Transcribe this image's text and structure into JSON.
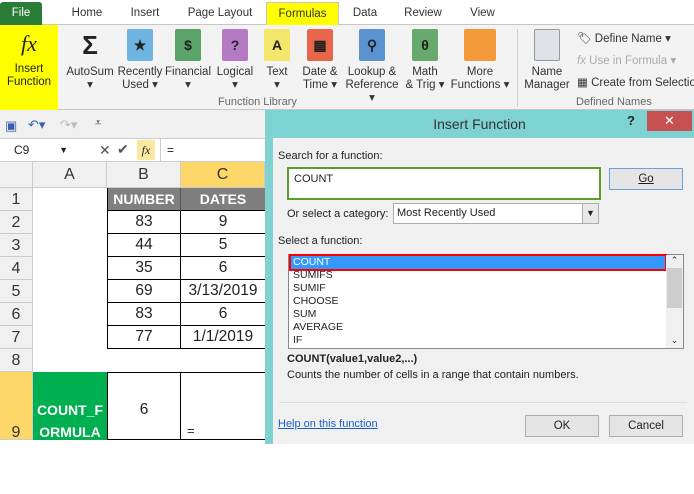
{
  "tabs": [
    "File",
    "Home",
    "Insert",
    "Page Layout",
    "Formulas",
    "Data",
    "Review",
    "View"
  ],
  "ribbon": {
    "insert_function": [
      "Insert",
      "Function"
    ],
    "buttons": [
      {
        "l1": "AutoSum",
        "l2": "▾",
        "icon": "sigma-icon"
      },
      {
        "l1": "Recently",
        "l2": "Used ▾",
        "icon": "star-book-icon"
      },
      {
        "l1": "Financial",
        "l2": "▾",
        "icon": "financial-book-icon"
      },
      {
        "l1": "Logical",
        "l2": "▾",
        "icon": "question-book-icon"
      },
      {
        "l1": "Text",
        "l2": "▾",
        "icon": "text-book-icon"
      },
      {
        "l1": "Date &",
        "l2": "Time ▾",
        "icon": "calendar-book-icon"
      },
      {
        "l1": "Lookup &",
        "l2": "Reference ▾",
        "icon": "magnifier-book-icon"
      },
      {
        "l1": "Math",
        "l2": "& Trig ▾",
        "icon": "theta-book-icon"
      },
      {
        "l1": "More",
        "l2": "Functions ▾",
        "icon": "books-icon"
      }
    ],
    "function_library": "Function Library",
    "name_manager": [
      "Name",
      "Manager"
    ],
    "define_name": "Define Name ▾",
    "use_in_formula": "Use in Formula ▾",
    "create_from_selection": "Create from Selection",
    "defined_names": "Defined Names"
  },
  "formula_bar": {
    "name_box": "C9",
    "formula": "="
  },
  "sheet": {
    "columns": [
      "A",
      "B",
      "C"
    ],
    "rows": [
      "1",
      "2",
      "3",
      "4",
      "5",
      "6",
      "7",
      "8",
      "9"
    ],
    "header": [
      "NUMBER",
      "DATES"
    ],
    "data": [
      [
        "83",
        "9"
      ],
      [
        "44",
        "5"
      ],
      [
        "35",
        "6"
      ],
      [
        "69",
        "3/13/2019"
      ],
      [
        "83",
        "6"
      ],
      [
        "77",
        "1/1/2019"
      ]
    ],
    "a9": "COUNT_FORMULA",
    "b9": "6",
    "c9": "="
  },
  "dialog": {
    "title": "Insert Function",
    "help": "?",
    "search_label": "Search for a function:",
    "search_value": "COUNT",
    "go": "Go",
    "category_label": "Or select a category:",
    "category": "Most Recently Used",
    "select_label": "Select a function:",
    "functions": [
      "COUNT",
      "SUMIFS",
      "SUMIF",
      "CHOOSE",
      "SUM",
      "AVERAGE",
      "IF"
    ],
    "signature": "COUNT(value1,value2,...)",
    "description": "Counts the number of cells in a range that contain numbers.",
    "help_link": "Help on this function",
    "ok": "OK",
    "cancel": "Cancel"
  },
  "colors": {
    "highlight": "#ffff00",
    "green": "#00b050",
    "selection": "#3399ff",
    "red": "#ff0000"
  }
}
